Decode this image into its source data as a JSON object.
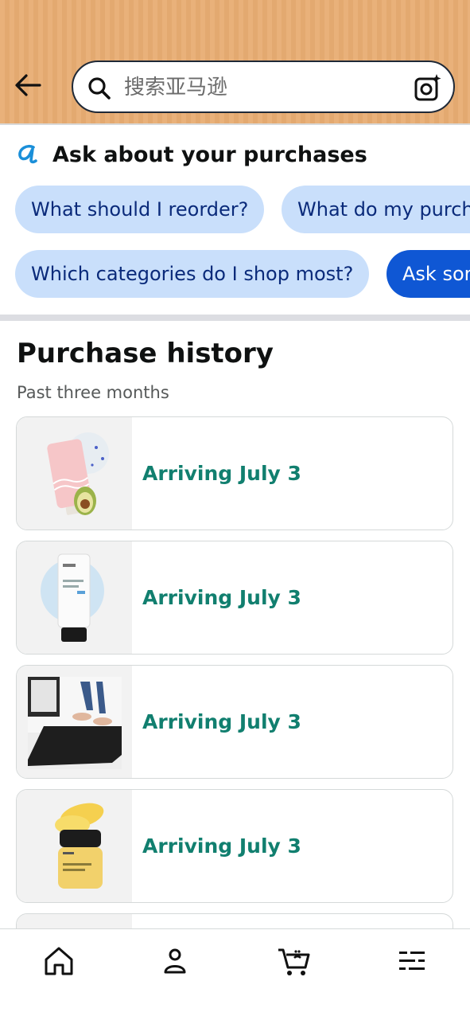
{
  "search": {
    "placeholder": "搜索亚马逊"
  },
  "ask": {
    "title": "Ask about your purchases",
    "chips": [
      {
        "label": "What should I reorder?"
      },
      {
        "label": "What do my purchases say about me?"
      },
      {
        "label": "Which categories do I shop most?"
      },
      {
        "label": "Ask something else"
      }
    ]
  },
  "purchase_history": {
    "title": "Purchase history",
    "subtitle": "Past three months",
    "orders": [
      {
        "status": "Arriving July 3",
        "product_icon": "pink-cleanser-tube-with-avocado"
      },
      {
        "status": "Arriving July 3",
        "product_icon": "white-cleanser-tube"
      },
      {
        "status": "Arriving July 3",
        "product_icon": "black-kitchen-floor-mat"
      },
      {
        "status": "Arriving July 3",
        "product_icon": "yellow-cream-jar"
      }
    ]
  },
  "nav": {
    "items": [
      "home-icon",
      "account-icon",
      "cart-icon",
      "menu-icon"
    ]
  },
  "colors": {
    "header_bg": "#e9b17a",
    "chip_bg": "#c9dffb",
    "chip_dark_bg": "#0f57d4",
    "status_text": "#117f6f"
  }
}
